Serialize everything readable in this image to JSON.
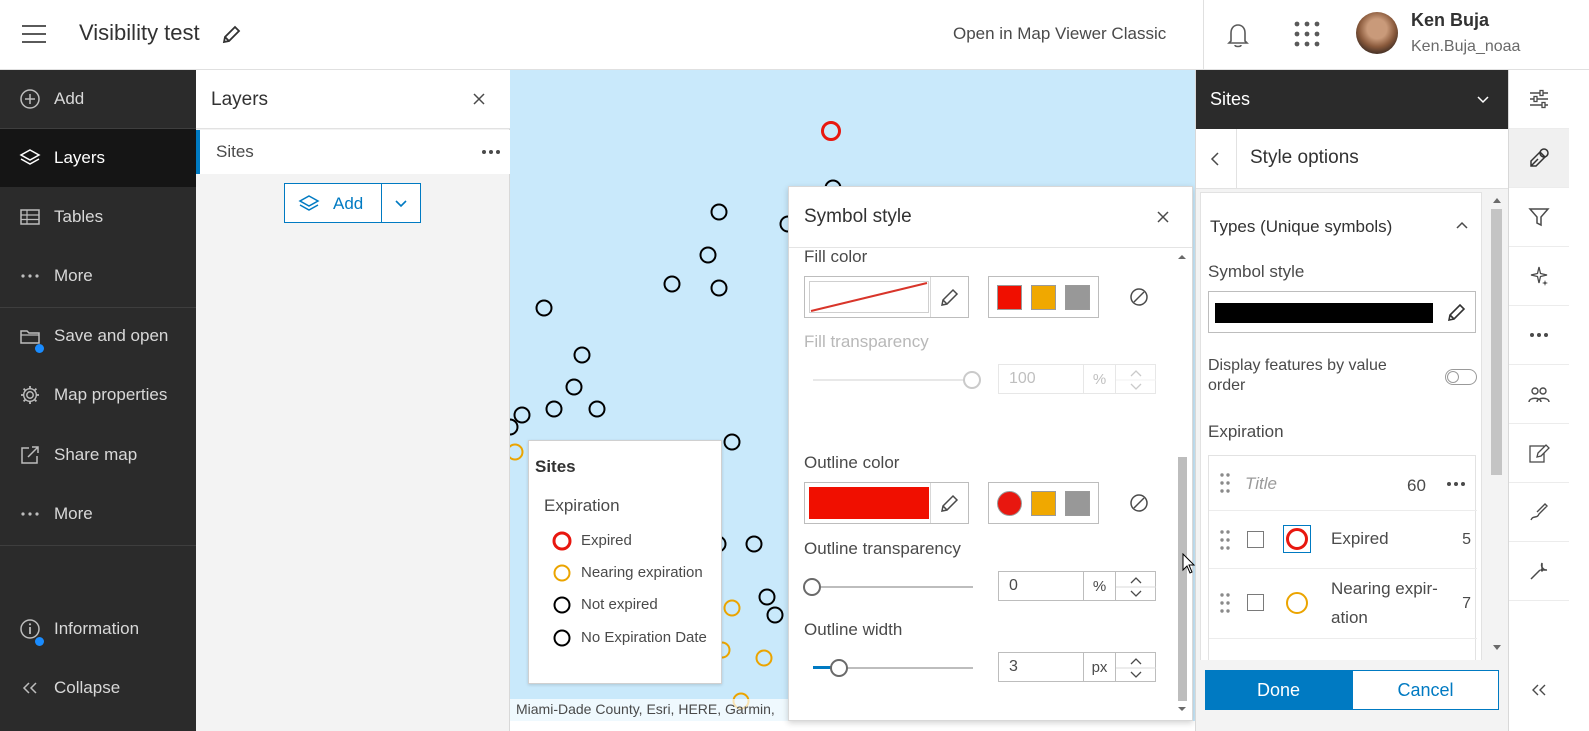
{
  "header": {
    "title": "Visibility test",
    "open_classic": "Open in Map Viewer Classic",
    "user_name": "Ken Buja",
    "user_id": "Ken.Buja_noaa"
  },
  "leftnav": {
    "items": [
      {
        "label": "Add",
        "icon": "add-circle-icon"
      },
      {
        "label": "Layers",
        "icon": "layers-icon"
      },
      {
        "label": "Tables",
        "icon": "table-icon"
      },
      {
        "label": "More",
        "icon": "ellipsis-icon"
      },
      {
        "label": "Save and open",
        "icon": "folder-icon"
      },
      {
        "label": "Map properties",
        "icon": "gear-icon"
      },
      {
        "label": "Share map",
        "icon": "share-icon"
      },
      {
        "label": "More",
        "icon": "ellipsis-icon"
      },
      {
        "label": "Information",
        "icon": "info-icon"
      },
      {
        "label": "Collapse",
        "icon": "double-chevron-left-icon"
      }
    ]
  },
  "layers_panel": {
    "title": "Layers",
    "layer_name": "Sites",
    "add_label": "Add"
  },
  "map": {
    "attribution": "Miami-Dade County, Esri, HERE, Garmin,",
    "background_color": "#c9e9fb"
  },
  "legend": {
    "title": "Sites",
    "field": "Expiration",
    "items": [
      {
        "label": "Expired",
        "color": "#e8170f"
      },
      {
        "label": "Nearing expiration",
        "color": "#eba400"
      },
      {
        "label": "Not expired",
        "color": "#000000"
      },
      {
        "label": "No Expiration Date",
        "color": "#000000"
      }
    ]
  },
  "symbol_style": {
    "title": "Symbol style",
    "fill_color_label": "Fill color",
    "fill_transparency_label": "Fill transparency",
    "fill_transparency_value": "100",
    "fill_transparency_unit": "%",
    "outline_color_label": "Outline color",
    "outline_color": "#f00f00",
    "outline_transparency_label": "Outline transparency",
    "outline_transparency_value": "0",
    "outline_transparency_unit": "%",
    "outline_width_label": "Outline width",
    "outline_width_value": "3",
    "outline_width_unit": "px",
    "recent_fill_colors": [
      "#f00f00",
      "#f0a800",
      "#989898"
    ],
    "recent_outline_colors": [
      "#e8170f",
      "#f0a800",
      "#989898"
    ]
  },
  "right_panel": {
    "title": "Sites",
    "subtitle": "Style options",
    "section_title": "Types (Unique symbols)",
    "symbol_style_label": "Symbol style",
    "order_label": "Display features by value order",
    "field_label": "Expiration",
    "title_placeholder": "Title",
    "title_count": "60",
    "rows": [
      {
        "label": "Expired",
        "count": "5",
        "color": "#e8170f"
      },
      {
        "label": "Nearing expir­ation",
        "count": "7",
        "color": "#eba400"
      }
    ],
    "done": "Done",
    "cancel": "Cancel"
  },
  "tool_rail": {
    "tools": [
      "properties-icon",
      "styles-icon",
      "filter-icon",
      "effects-icon",
      "more-icon",
      "pop-ups-icon",
      "edit-icon",
      "sketch-icon",
      "configure-icon"
    ]
  }
}
